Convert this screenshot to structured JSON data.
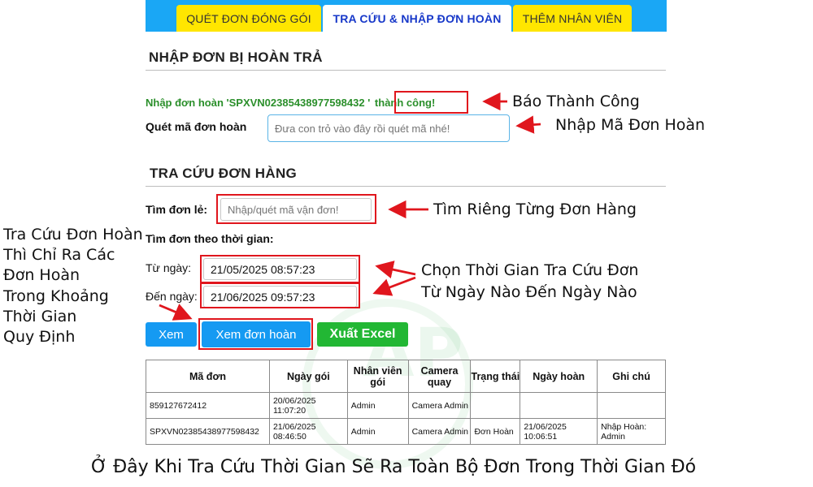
{
  "tabs": [
    {
      "label": "QUÉT ĐƠN ĐÓNG GÓI",
      "active": false
    },
    {
      "label": "TRA CỨU & NHẬP ĐƠN HOÀN",
      "active": true
    },
    {
      "label": "THÊM NHÂN VIÊN",
      "active": false
    }
  ],
  "return_section": {
    "title": "NHẬP ĐƠN BỊ HOÀN TRẢ",
    "success_prefix": "Nhập đơn hoàn 'SPXVN02385438977598432 '",
    "success_word": "thành công!",
    "scan_label": "Quét mã đơn hoàn",
    "scan_placeholder": "Đưa con trỏ vào đây rồi quét mã nhé!"
  },
  "lookup_section": {
    "title": "TRA CỨU ĐƠN HÀNG",
    "single_label": "Tìm đơn lẻ:",
    "single_placeholder": "Nhập/quét mã vận đơn!",
    "time_label": "Tìm đơn theo thời gian:",
    "from_label": "Từ ngày:",
    "from_value": "21/05/2025 08:57:23",
    "to_label": "Đến ngày:",
    "to_value": "21/06/2025 09:57:23",
    "buttons": {
      "view": "Xem",
      "view_returns": "Xem đơn hoàn",
      "export": "Xuất Excel"
    }
  },
  "table": {
    "headers": [
      "Mã đơn",
      "Ngày gói",
      "Nhân viên gói",
      "Camera quay",
      "Trạng thái",
      "Ngày hoàn",
      "Ghi chú"
    ],
    "rows": [
      [
        "859127672412",
        "20/06/2025 11:07:20",
        "Admin",
        "Camera Admin",
        "",
        "",
        ""
      ],
      [
        "SPXVN02385438977598432",
        "21/06/2025 08:46:50",
        "Admin",
        "Camera Admin",
        "Đơn Hoàn",
        "21/06/2025 10:06:51",
        "Nhập Hoàn: Admin"
      ]
    ]
  },
  "annotations": {
    "success": "Báo Thành Công",
    "scan": "Nhập Mã Đơn Hoàn",
    "single": "Tìm Riêng Từng Đơn Hàng",
    "time_1": "Chọn Thời Gian Tra Cứu Đơn",
    "time_2": "Từ Ngày Nào Đến Ngày Nào",
    "left_note": [
      "Tra Cứu Đơn Hoàn",
      "Thì Chỉ Ra Các",
      "Đơn Hoàn",
      "Trong Khoảng",
      "Thời Gian",
      "Quy Định"
    ],
    "bottom": "Ở Đây Khi Tra Cứu Thời Gian Sẽ Ra Toàn Bộ Đơn Trong Thời Gian Đó"
  },
  "colors": {
    "tab_bar": "#1aa7f5",
    "tab_yellow": "#ffe600",
    "success_green": "#2b8f2b",
    "highlight_red": "#e0161d",
    "button_blue": "#159af2",
    "button_green": "#22b734"
  }
}
